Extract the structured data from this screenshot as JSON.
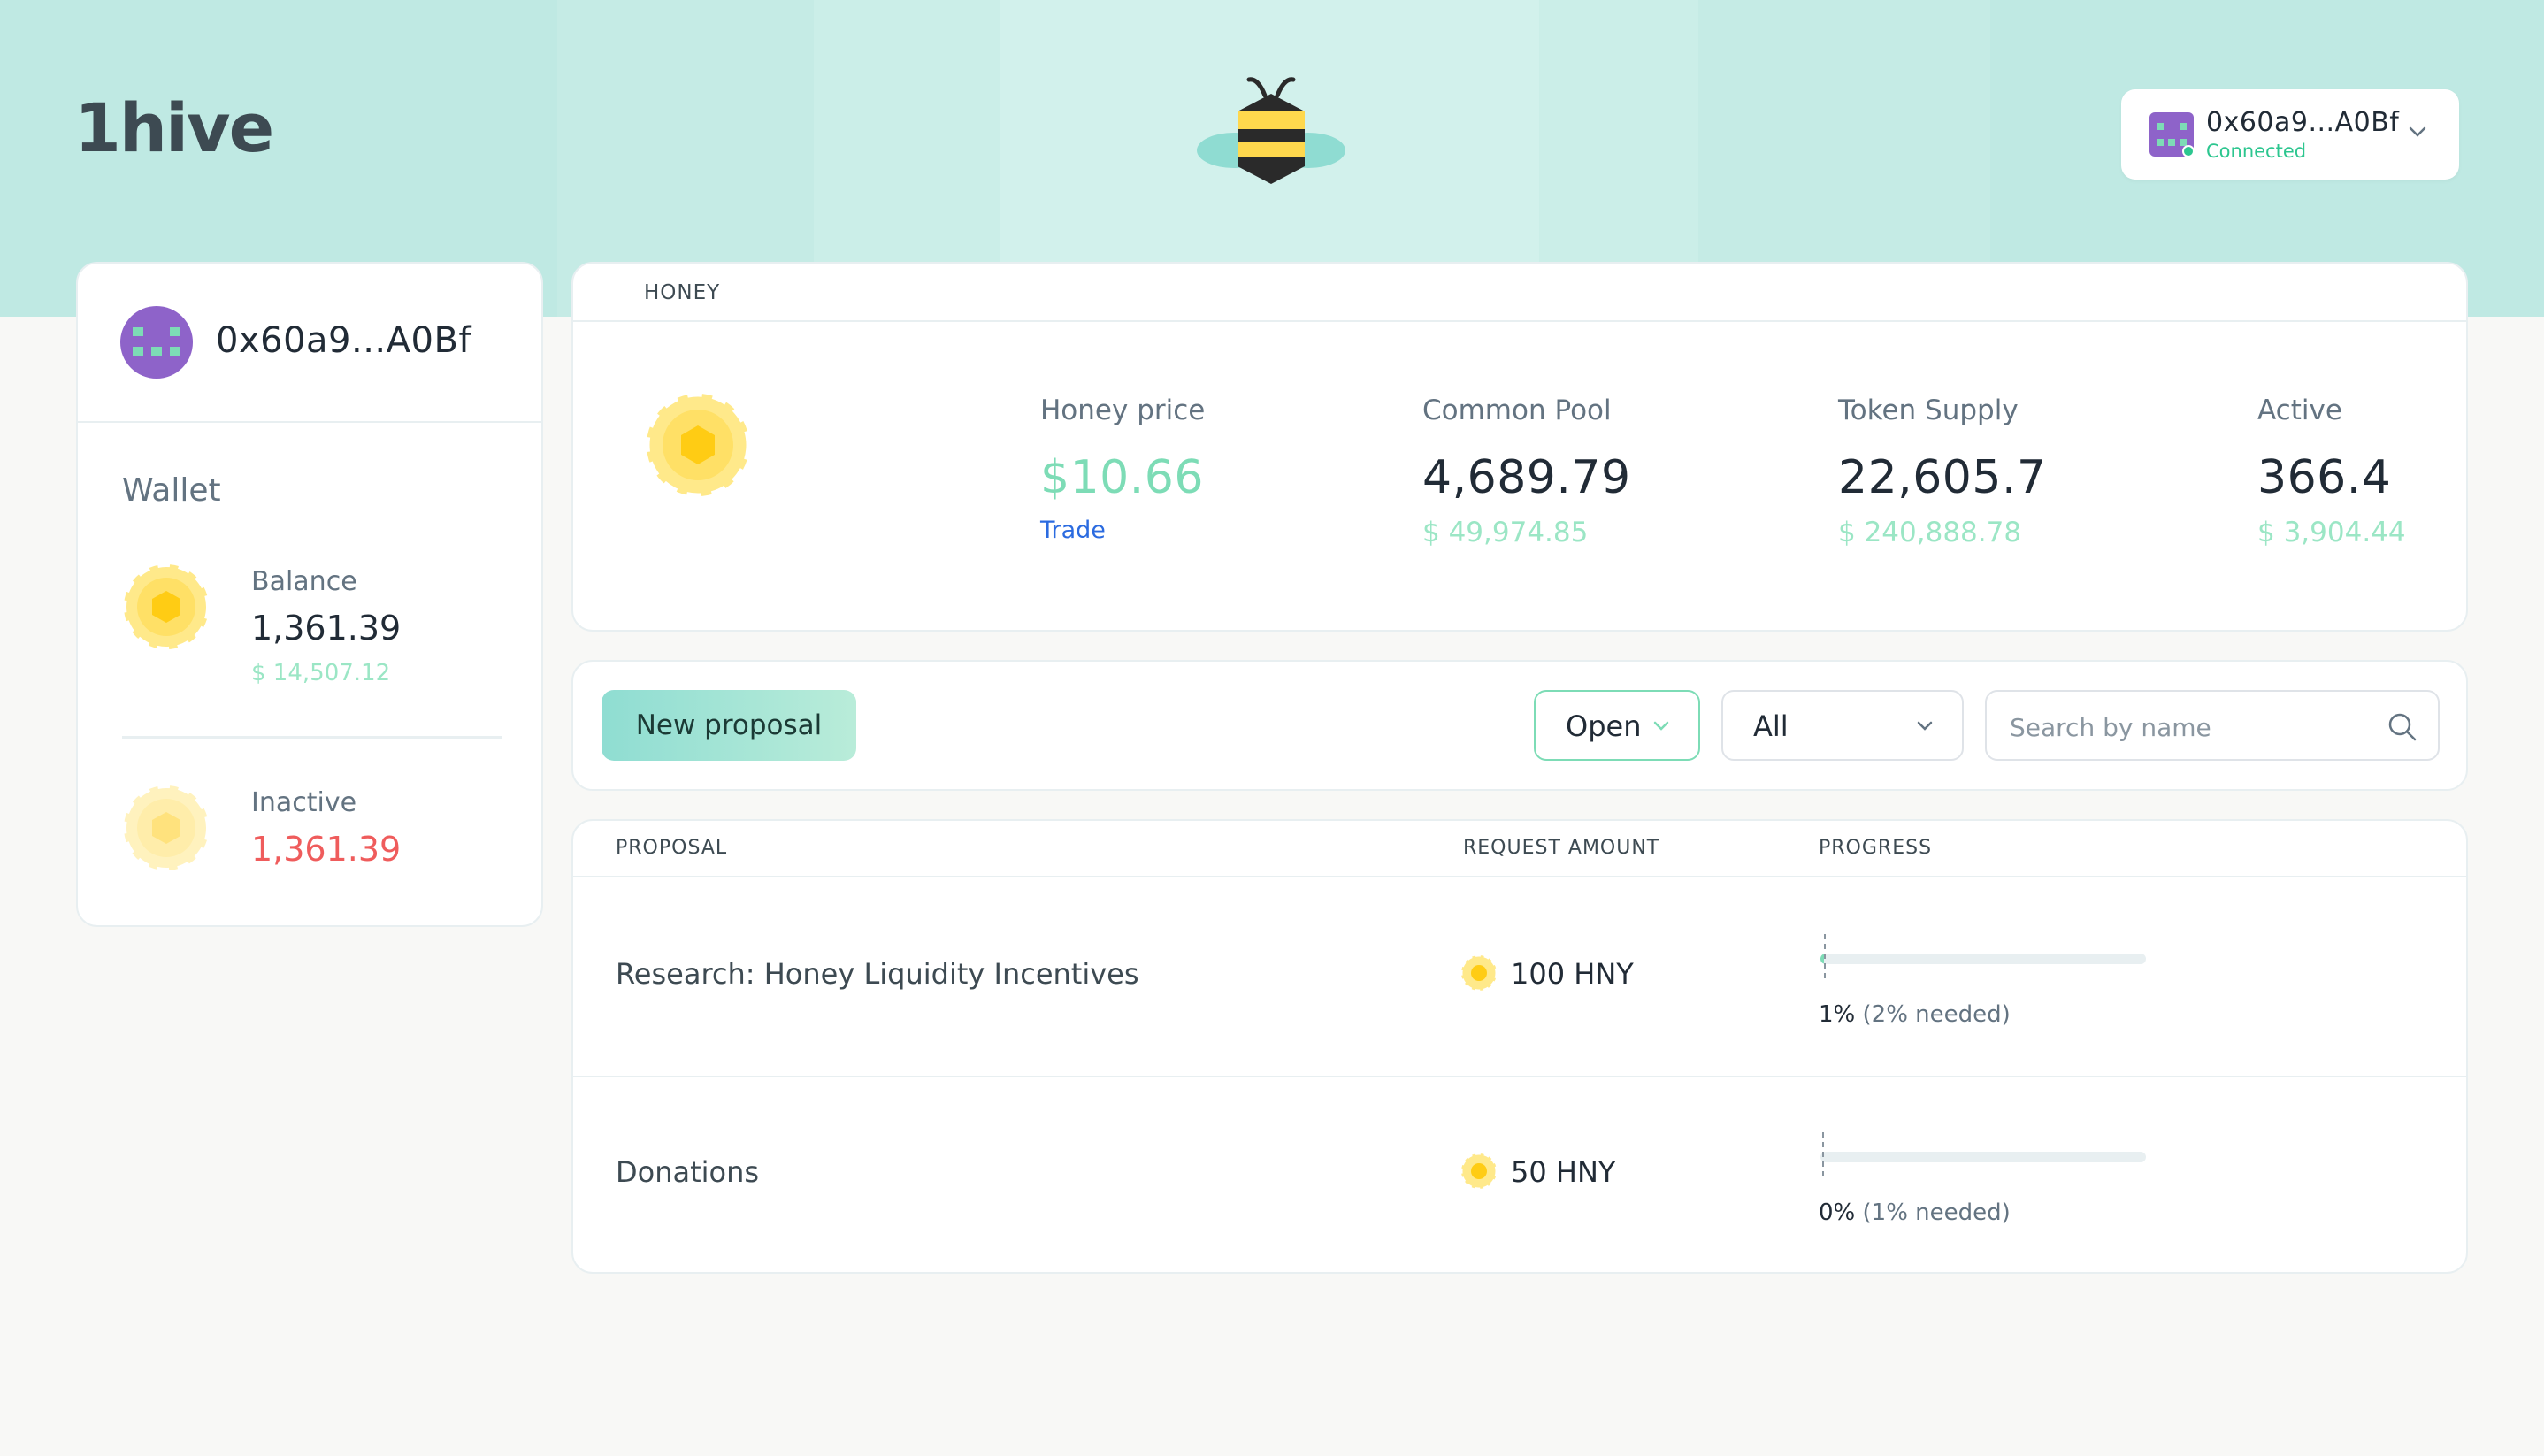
{
  "header": {
    "brand": "1hive",
    "bee_logo": "bee-logo-icon",
    "account": {
      "address": "0x60a9...A0Bf",
      "status": "Connected",
      "avatar": "identicon-avatar-icon"
    }
  },
  "sidebar": {
    "address": "0x60a9...A0Bf",
    "wallet_title": "Wallet",
    "balance": {
      "label": "Balance",
      "value": "1,361.39",
      "usd": "$ 14,507.12"
    },
    "inactive": {
      "label": "Inactive",
      "value": "1,361.39"
    }
  },
  "honey": {
    "title": "HONEY",
    "token_icon": "honey-token-icon",
    "price": {
      "label": "Honey price",
      "value": "$10.66",
      "link": "Trade"
    },
    "common_pool": {
      "label": "Common Pool",
      "value": "4,689.79",
      "usd": "$ 49,974.85"
    },
    "token_supply": {
      "label": "Token Supply",
      "value": "22,605.7",
      "usd": "$ 240,888.78"
    },
    "active": {
      "label": "Active",
      "value": "366.4",
      "usd": "$ 3,904.44"
    }
  },
  "filters": {
    "new_proposal": "New proposal",
    "status_select": "Open",
    "type_select": "All",
    "search_placeholder": "Search by name"
  },
  "table": {
    "columns": [
      "PROPOSAL",
      "REQUEST AMOUNT",
      "PROGRESS"
    ],
    "rows": [
      {
        "name": "Research: Honey Liquidity Incentives",
        "amount": "100 HNY",
        "progress_pct": "1%",
        "needed": "(2% needed)",
        "progress": 0.01
      },
      {
        "name": "Donations",
        "amount": "50 HNY",
        "progress_pct": "0%",
        "needed": "(1% needed)",
        "progress": 0.0
      }
    ]
  },
  "colors": {
    "header_band": "#bfe9e3",
    "accent_green": "#7ddcb6",
    "usd_green": "#9be6c5",
    "negative_red": "#ef5c5c",
    "link_blue": "#2b6be0",
    "honey_yellow": "#ffd84d"
  }
}
